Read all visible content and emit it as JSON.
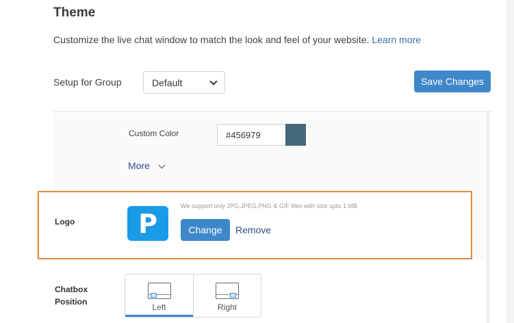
{
  "header": {
    "title": "Theme",
    "description": "Customize the live chat window to match the look and feel of your website.",
    "learn_more": "Learn more"
  },
  "group": {
    "label": "Setup for Group",
    "selected": "Default",
    "save_label": "Save Changes"
  },
  "custom_color": {
    "label": "Custom Color",
    "value": "#456979",
    "swatch_color": "#456979"
  },
  "more": {
    "label": "More"
  },
  "logo": {
    "label": "Logo",
    "letter": "P",
    "logo_color": "#1a9be6",
    "support_note": "We support only JPG,JPEG,PNG & GIF files with size upto 1 MB",
    "change_label": "Change",
    "remove_label": "Remove"
  },
  "chatbox_position": {
    "label": "Chatbox Position",
    "options": [
      {
        "label": "Left",
        "active": true
      },
      {
        "label": "Right",
        "active": false
      }
    ]
  },
  "colors": {
    "accent": "#3e88c9",
    "highlight_border": "#e08a3e",
    "link": "#2d4f86"
  }
}
